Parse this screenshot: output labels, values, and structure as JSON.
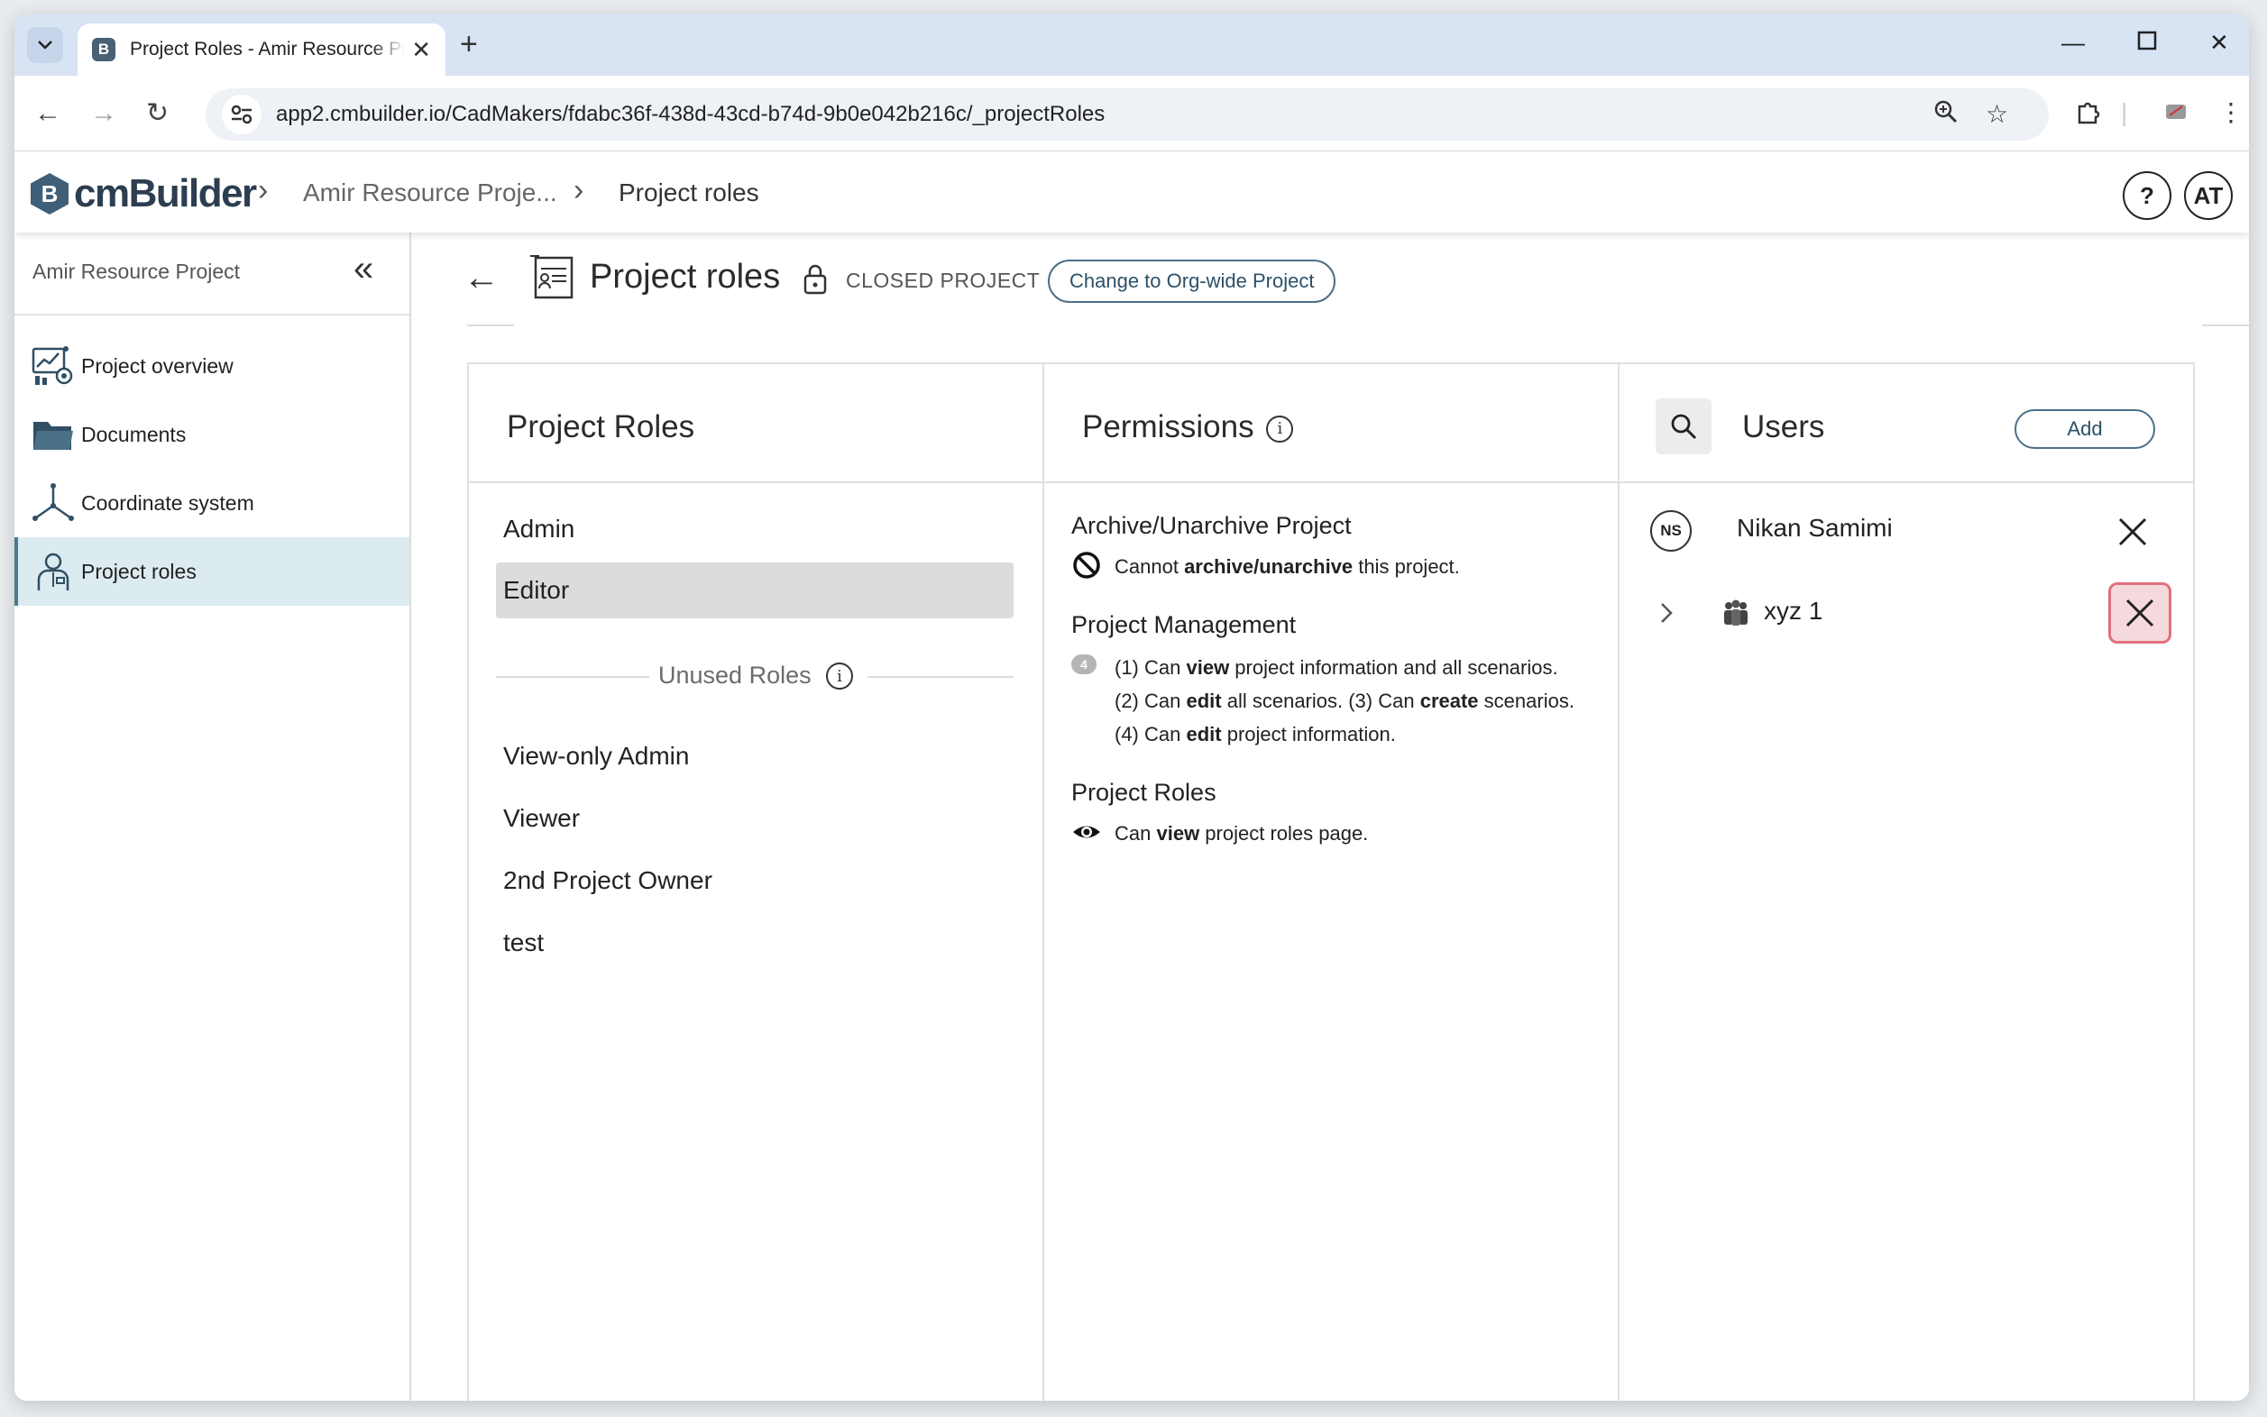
{
  "browser": {
    "tab_title": "Project Roles - Amir Resource Project",
    "favicon_letter": "B",
    "url": "app2.cmbuilder.io/CadMakers/fdabc36f-438d-43cd-b74d-9b0e042b216c/_projectRoles"
  },
  "header": {
    "logo_text": "cmBuilder",
    "logo_letter": "B",
    "breadcrumb": [
      "Amir Resource Proje...",
      "Project roles"
    ],
    "help_label": "?",
    "user_initials": "AT"
  },
  "sidebar": {
    "project_name": "Amir Resource Project",
    "items": [
      {
        "label": "Project overview",
        "icon": "project-overview-icon"
      },
      {
        "label": "Documents",
        "icon": "folder-icon"
      },
      {
        "label": "Coordinate system",
        "icon": "axes-icon"
      },
      {
        "label": "Project roles",
        "icon": "user-role-icon",
        "active": true
      }
    ]
  },
  "page": {
    "title": "Project roles",
    "status": "CLOSED PROJECT",
    "change_button": "Change to Org-wide Project"
  },
  "roles_panel": {
    "title": "Project Roles",
    "roles": [
      "Admin",
      "Editor"
    ],
    "selected": "Editor",
    "unused_label": "Unused Roles",
    "unused_roles": [
      "View-only Admin",
      "Viewer",
      "2nd Project Owner",
      "test"
    ]
  },
  "permissions_panel": {
    "title": "Permissions",
    "sections": [
      {
        "title": "Archive/Unarchive Project",
        "lines": [
          {
            "pre": "Cannot ",
            "bold": "archive/unarchive",
            "post": " this project."
          }
        ]
      },
      {
        "title": "Project Management",
        "count": "4",
        "lines": [
          {
            "pre": "(1) Can ",
            "bold": "view",
            "post": " project information and all scenarios."
          },
          {
            "pre": "(2) Can ",
            "bold": "edit",
            "post": " all scenarios. (3) Can ",
            "bold2": "create",
            "post2": " scenarios."
          },
          {
            "pre": "(4) Can ",
            "bold": "edit",
            "post": " project information."
          }
        ]
      },
      {
        "title": "Project Roles",
        "lines": [
          {
            "pre": "Can ",
            "bold": "view",
            "post": " project roles page."
          }
        ]
      }
    ]
  },
  "users_panel": {
    "title": "Users",
    "add_label": "Add",
    "users": [
      {
        "initials": "NS",
        "name": "Nikan Samimi",
        "type": "user"
      },
      {
        "name": "xyz 1",
        "type": "group"
      }
    ]
  },
  "colors": {
    "accent": "#4a7088",
    "active_sidebar": "#dcebf0",
    "remove_hover_bg": "#f5dadd",
    "remove_hover_border": "#e0707e"
  }
}
